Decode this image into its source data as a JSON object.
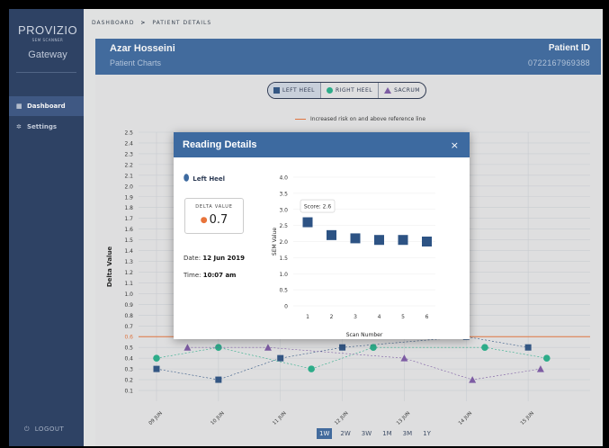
{
  "sidebar": {
    "brand": "PROVIZIO",
    "brand_sub": "SEM SCANNER",
    "app_name": "Gateway",
    "items": [
      {
        "label": "Dashboard",
        "icon": "grid-icon",
        "active": true
      },
      {
        "label": "Settings",
        "icon": "gear-icon",
        "active": false
      }
    ],
    "logout_label": "LOGOUT"
  },
  "breadcrumb": {
    "root": "DASHBOARD",
    "separator": ">",
    "current": "PATIENT DETAILS"
  },
  "header": {
    "patient_name": "Azar Hosseini",
    "subtitle": "Patient Charts",
    "pid_label": "Patient ID",
    "pid_value": "0722167969388"
  },
  "legend": {
    "items": [
      {
        "label": "LEFT HEEL",
        "marker": "square",
        "color": "#2d5384"
      },
      {
        "label": "RIGHT HEEL",
        "marker": "circle",
        "color": "#26b08a"
      },
      {
        "label": "SACRUM",
        "marker": "triangle",
        "color": "#7d5aa6"
      }
    ],
    "reference_note": "Increased risk on and above reference line"
  },
  "range_buttons": [
    "1W",
    "2W",
    "3W",
    "1M",
    "3M",
    "1Y"
  ],
  "range_selected": "1W",
  "chart_data": {
    "type": "scatter",
    "ylabel": "Delta Value",
    "ylim": [
      0,
      2.5
    ],
    "yticks": [
      "0.1",
      "0.2",
      "0.3",
      "0.4",
      "0.5",
      "0.6",
      "0.7",
      "0.8",
      "0.9",
      "1.0",
      "1.1",
      "1.2",
      "1.3",
      "1.4",
      "1.5",
      "1.6",
      "1.7",
      "1.8",
      "1.9",
      "2.0",
      "2.1",
      "2.2",
      "2.3",
      "2.4",
      "2.5"
    ],
    "highlight_tick": "0.6",
    "reference_line": 0.6,
    "reference_color": "#e8743b",
    "x_labels": [
      "09 JUN",
      "10 JUN",
      "11 JUN",
      "12 JUN",
      "13 JUN",
      "14 JUN",
      "15 JUN"
    ],
    "series": [
      {
        "name": "LEFT HEEL",
        "color": "#2d5384",
        "marker": "square",
        "points": [
          [
            0,
            0.3
          ],
          [
            1,
            0.2
          ],
          [
            2,
            0.4
          ],
          [
            3,
            0.5
          ],
          [
            5,
            0.6
          ],
          [
            6,
            0.5
          ]
        ]
      },
      {
        "name": "RIGHT HEEL",
        "color": "#26b08a",
        "marker": "circle",
        "points": [
          [
            0,
            0.4
          ],
          [
            1,
            0.5
          ],
          [
            2.5,
            0.3
          ],
          [
            3.5,
            0.5
          ],
          [
            5.3,
            0.5
          ],
          [
            6.3,
            0.4
          ]
        ]
      },
      {
        "name": "SACRUM",
        "color": "#7d5aa6",
        "marker": "triangle",
        "points": [
          [
            0.5,
            0.5
          ],
          [
            1.8,
            0.5
          ],
          [
            4,
            0.4
          ],
          [
            5.1,
            0.2
          ],
          [
            6.2,
            0.3
          ]
        ]
      }
    ]
  },
  "modal": {
    "title": "Reading Details",
    "close_glyph": "×",
    "location": "Left Heel",
    "delta_label": "DELTA VALUE",
    "delta_value": "0.7",
    "date_label": "Date:",
    "date_value": "12 Jun 2019",
    "time_label": "Time:",
    "time_value": "10:07 am",
    "tooltip": "Score: 2.6",
    "chart_data": {
      "type": "scatter",
      "xlabel": "Scan Number",
      "ylabel": "SEM Value",
      "ylim": [
        0,
        4.0
      ],
      "yticks": [
        "0",
        "0.5",
        "1.0",
        "1.5",
        "2.0",
        "2.5",
        "3.0",
        "3.5",
        "4.0"
      ],
      "x": [
        1,
        2,
        3,
        4,
        5,
        6
      ],
      "values": [
        2.6,
        2.2,
        2.1,
        2.05,
        2.05,
        2.0
      ],
      "color": "#2d5384"
    }
  }
}
